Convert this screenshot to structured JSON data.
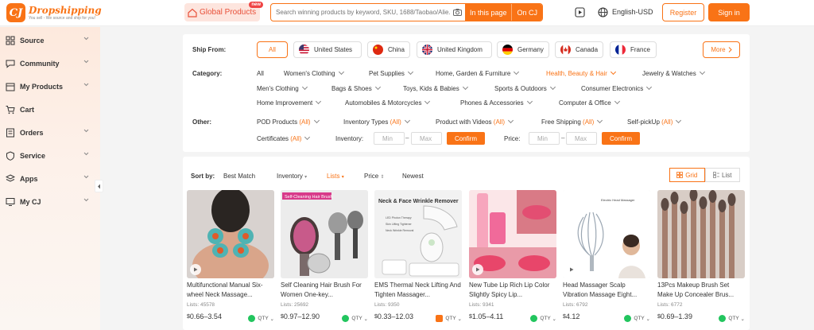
{
  "brand": {
    "logo_letters": "CJ",
    "name": "Dropshipping",
    "tagline": "You sell - We source and ship for you!"
  },
  "header": {
    "global_products": "Global Products",
    "new_badge": "new",
    "search_placeholder": "Search winning products by keyword, SKU, 1688/Taobao/Alie...",
    "in_this_page": "In this page",
    "on_cj": "On CJ",
    "language": "English-USD",
    "register": "Register",
    "sign_in": "Sign in"
  },
  "sidebar": {
    "items": [
      {
        "label": "Source",
        "icon": "grid-icon"
      },
      {
        "label": "Community",
        "icon": "community-icon"
      },
      {
        "label": "My Products",
        "icon": "box-icon"
      },
      {
        "label": "Cart",
        "icon": "cart-icon"
      },
      {
        "label": "Orders",
        "icon": "orders-icon"
      },
      {
        "label": "Service",
        "icon": "service-icon"
      },
      {
        "label": "Apps",
        "icon": "apps-icon"
      },
      {
        "label": "My CJ",
        "icon": "monitor-icon"
      }
    ]
  },
  "filters": {
    "ship_from_label": "Ship From:",
    "ship_from": [
      {
        "label": "All",
        "active": true
      },
      {
        "label": "United States",
        "flag": "us"
      },
      {
        "label": "China",
        "flag": "cn"
      },
      {
        "label": "United Kingdom",
        "flag": "uk"
      },
      {
        "label": "Germany",
        "flag": "de"
      },
      {
        "label": "Canada",
        "flag": "ca"
      },
      {
        "label": "France",
        "flag": "fr"
      }
    ],
    "more": "More",
    "category_label": "Category:",
    "categories": [
      "All",
      "Women's Clothing",
      "Pet Supplies",
      "Home, Garden & Furniture",
      "Health, Beauty & Hair",
      "Jewelry & Watches",
      "Men's Clothing",
      "Bags & Shoes",
      "Toys, Kids & Babies",
      "Sports & Outdoors",
      "Consumer Electronics",
      "Home Improvement",
      "Automobiles & Motorcycles",
      "Phones & Accessories",
      "Computer & Office"
    ],
    "active_category": "Health, Beauty & Hair",
    "other_label": "Other:",
    "other": [
      {
        "label": "POD Products",
        "value": "(All)"
      },
      {
        "label": "Inventory Types",
        "value": "(All)"
      },
      {
        "label": "Product with Videos",
        "value": "(All)"
      },
      {
        "label": "Free Shipping",
        "value": "(All)"
      },
      {
        "label": "Self-pickUp",
        "value": "(All)"
      },
      {
        "label": "Certificates",
        "value": "(All)"
      }
    ],
    "inventory_label": "Inventory:",
    "price_label": "Price:",
    "min_placeholder": "Min",
    "max_placeholder": "Max",
    "dash": "–",
    "confirm": "Confirm"
  },
  "sort": {
    "label": "Sort by:",
    "options": [
      "Best Match",
      "Inventory",
      "Lists",
      "Price",
      "Newest"
    ],
    "active": "Lists",
    "grid": "Grid",
    "list": "List"
  },
  "products": [
    {
      "title": "Multifunctional Manual Six-wheel Neck Massage...",
      "lists": "Lists: 45578",
      "price": "0.66–3.54",
      "qty": "QTY"
    },
    {
      "title": "Self Cleaning Hair Brush For Women One-key...",
      "lists": "Lists: 25692",
      "price": "0.97–12.90",
      "qty": "QTY",
      "banner": "Self-Cleaning Hair Brush"
    },
    {
      "title": "EMS Thermal Neck Lifting And Tighten Massager...",
      "lists": "Lists: 9350",
      "price": "0.33–12.03",
      "qty": "QTY",
      "banner": "Neck & Face Wrinkle Remover",
      "bullets": [
        "LED Photon Therapy",
        "Skin Lifting Tightener",
        "Neck Wrinkle Removal"
      ]
    },
    {
      "title": "New Tube Lip Rich Lip Color Slightly Spicy Lip...",
      "lists": "Lists: 9341",
      "price": "1.05–4.11",
      "qty": "QTY"
    },
    {
      "title": "Head Massager Scalp Vibration Massage Eight...",
      "lists": "Lists: 6792",
      "price": "4.12",
      "qty": "QTY",
      "banner": "Electric Head Massager"
    },
    {
      "title": "13Pcs Makeup Brush Set Make Up Concealer Brus...",
      "lists": "Lists: 6772",
      "price": "0.69–1.39",
      "qty": "QTY"
    }
  ],
  "currency": "$",
  "colors": {
    "accent": "#f97316",
    "panel": "#ffffff",
    "page_bg": "#f4f4f4"
  }
}
